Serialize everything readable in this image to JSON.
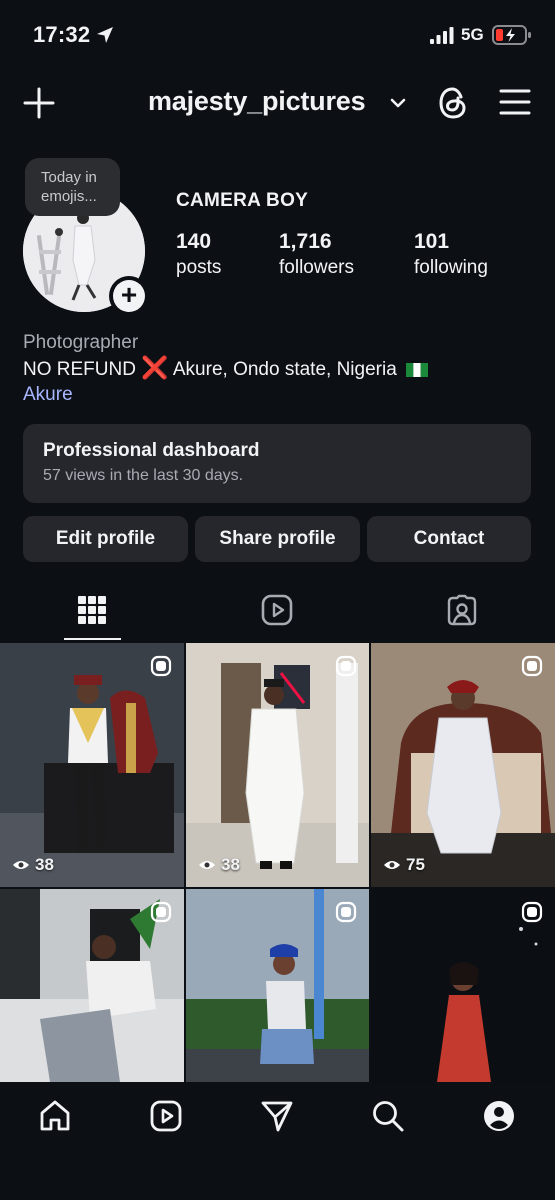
{
  "status_bar": {
    "time": "17:32",
    "network": "5G"
  },
  "header": {
    "username": "majesty_pictures"
  },
  "profile": {
    "note": "Today in emojis...",
    "display_name": "CAMERA BOY",
    "stats": [
      {
        "value": "140",
        "label": "posts"
      },
      {
        "value": "1,716",
        "label": "followers"
      },
      {
        "value": "101",
        "label": "following"
      }
    ],
    "category": "Photographer",
    "bio_prefix": "NO REFUND",
    "bio_emoji": "❌",
    "bio_location": "Akure, Ondo state, Nigeria",
    "bio_link": "Akure"
  },
  "dashboard": {
    "title": "Professional dashboard",
    "subtitle": "57 views in the last 30 days."
  },
  "buttons": {
    "edit": "Edit profile",
    "share": "Share profile",
    "contact": "Contact"
  },
  "tabs": [
    "grid-icon",
    "reels-icon",
    "tagged-icon"
  ],
  "posts": [
    {
      "views": "38"
    },
    {
      "views": "38"
    },
    {
      "views": "75"
    },
    {
      "views": ""
    },
    {
      "views": ""
    },
    {
      "views": ""
    }
  ],
  "bottom_nav": [
    "home-icon",
    "reels-icon",
    "messages-icon",
    "search-icon",
    "profile-icon"
  ],
  "colors": {
    "background": "#0c1015",
    "card": "#25272c",
    "link": "#a8b5ff",
    "text": "#f2f3f5"
  }
}
